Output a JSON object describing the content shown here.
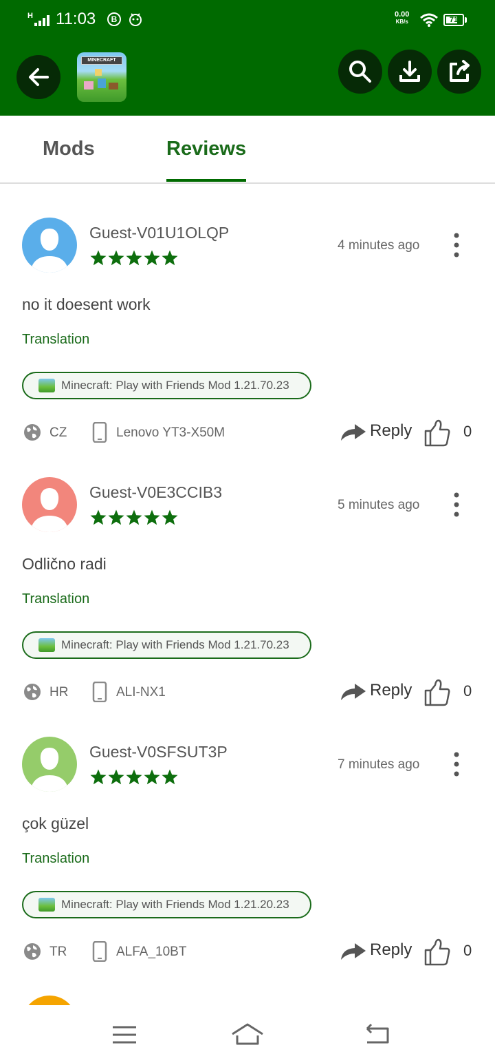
{
  "status_bar": {
    "network_label": "H",
    "time": "11:03",
    "b_icon_label": "B",
    "speed_value": "0.00",
    "speed_unit": "KB/s",
    "battery": "71",
    "battery_level": 0.71
  },
  "app_bar": {
    "logo_text": "MINECRAFT",
    "back_icon": "arrow-left-icon",
    "actions": [
      "search-icon",
      "download-icon",
      "share-icon"
    ]
  },
  "tabs": [
    {
      "label": "Mods",
      "active": false
    },
    {
      "label": "Reviews",
      "active": true
    }
  ],
  "reviews": [
    {
      "user": "Guest-V01U1OLQP",
      "avatar_color": "#5aaeea",
      "stars": 5,
      "time": "4 minutes ago",
      "comment": "no it doesent work",
      "translation": "Translation",
      "mod": "Minecraft: Play with Friends Mod 1.21.70.23",
      "country": "CZ",
      "device": "Lenovo YT3-X50M",
      "reply": "Reply",
      "likes": "0"
    },
    {
      "user": "Guest-V0E3CCIB3",
      "avatar_color": "#f2867c",
      "stars": 5,
      "time": "5 minutes ago",
      "comment": "Odlično radi",
      "translation": "Translation",
      "mod": "Minecraft: Play with Friends Mod 1.21.70.23",
      "country": "HR",
      "device": "ALI-NX1",
      "reply": "Reply",
      "likes": "0"
    },
    {
      "user": "Guest-V0SFSUT3P",
      "avatar_color": "#95cc6a",
      "stars": 5,
      "time": "7 minutes ago",
      "comment": "çok güzel",
      "translation": "Translation",
      "mod": "Minecraft: Play with Friends Mod 1.21.20.23",
      "country": "TR",
      "device": "ALFA_10BT",
      "reply": "Reply",
      "likes": "0"
    }
  ],
  "colors": {
    "brand_green": "#006a00",
    "star_green": "#0d6e0d",
    "tab_active": "#1a6b1a"
  },
  "nav": [
    "menu-icon",
    "home-icon",
    "back-icon"
  ]
}
